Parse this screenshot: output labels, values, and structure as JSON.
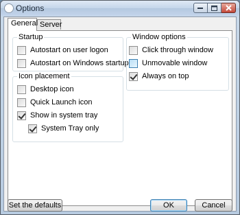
{
  "window": {
    "title": "Options"
  },
  "tabs": [
    {
      "label": "General",
      "active": true
    },
    {
      "label": "Server",
      "active": false
    }
  ],
  "startup": {
    "legend": "Startup",
    "options": [
      {
        "label": "Autostart on user logon",
        "checked": false
      },
      {
        "label": "Autostart on Windows startup",
        "checked": false
      }
    ]
  },
  "icon_placement": {
    "legend": "Icon placement",
    "options": [
      {
        "label": "Desktop icon",
        "checked": false
      },
      {
        "label": "Quick Launch icon",
        "checked": false
      },
      {
        "label": "Show in system tray",
        "checked": true
      },
      {
        "label": "System Tray only",
        "checked": true
      }
    ]
  },
  "window_options": {
    "legend": "Window options",
    "options": [
      {
        "label": "Click through window",
        "checked": false
      },
      {
        "label": "Unmovable window",
        "checked": false,
        "highlighted": true
      },
      {
        "label": "Always on top",
        "checked": true
      }
    ]
  },
  "buttons": {
    "defaults": "Set the defaults",
    "ok": "OK",
    "cancel": "Cancel"
  }
}
